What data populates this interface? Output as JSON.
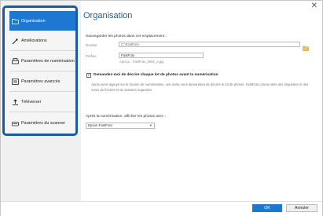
{
  "window": {
    "close_symbol": "✕"
  },
  "sidebar": {
    "items": [
      {
        "label": "Organisation",
        "icon": "folder-icon",
        "active": true
      },
      {
        "label": "Améliorations",
        "icon": "magic-wand-icon"
      },
      {
        "label": "Paramètres de numérisation",
        "icon": "scanner-icon"
      },
      {
        "label": "Paramètres avancés",
        "icon": "settings-panel-icon"
      },
      {
        "label": "Téléverser",
        "icon": "upload-icon"
      },
      {
        "label": "Paramètres du scanner",
        "icon": "scanner-settings-icon"
      }
    ]
  },
  "main": {
    "title": "Organisation",
    "save_location_label": "Sauvegarder les photos dans cet emplacement :",
    "folder_label": "Dossier",
    "folder_value": "C:\\FastFoto",
    "prefix_label": "Préfixe",
    "prefix_value": "FastFoto",
    "preview_text": "Aperçu : FastFoto_0001_a.jpg",
    "describe_checkbox_mark": "✓",
    "describe_checkbox_label": "Demandez-moi de décrire chaque lot de photos avant la numérisation",
    "description": "Après avoir appuyé sur le bouton de numérisation, une invite vous demandera de décrire le lot de photos. FastFoto créera alors des étiquettes et des noms de fichiers et de dossiers organisés.",
    "after_scan_label": "Après la numérisation, afficher les photos avec :",
    "viewer_value": "Epson FastFoto",
    "viewer_chevron": "▾"
  },
  "footer": {
    "ok_label": "OK",
    "cancel_label": "Annuler"
  },
  "colors": {
    "accent": "#1e78d2",
    "highlight_border": "#1a5aa8",
    "title": "#1b5ea8"
  }
}
